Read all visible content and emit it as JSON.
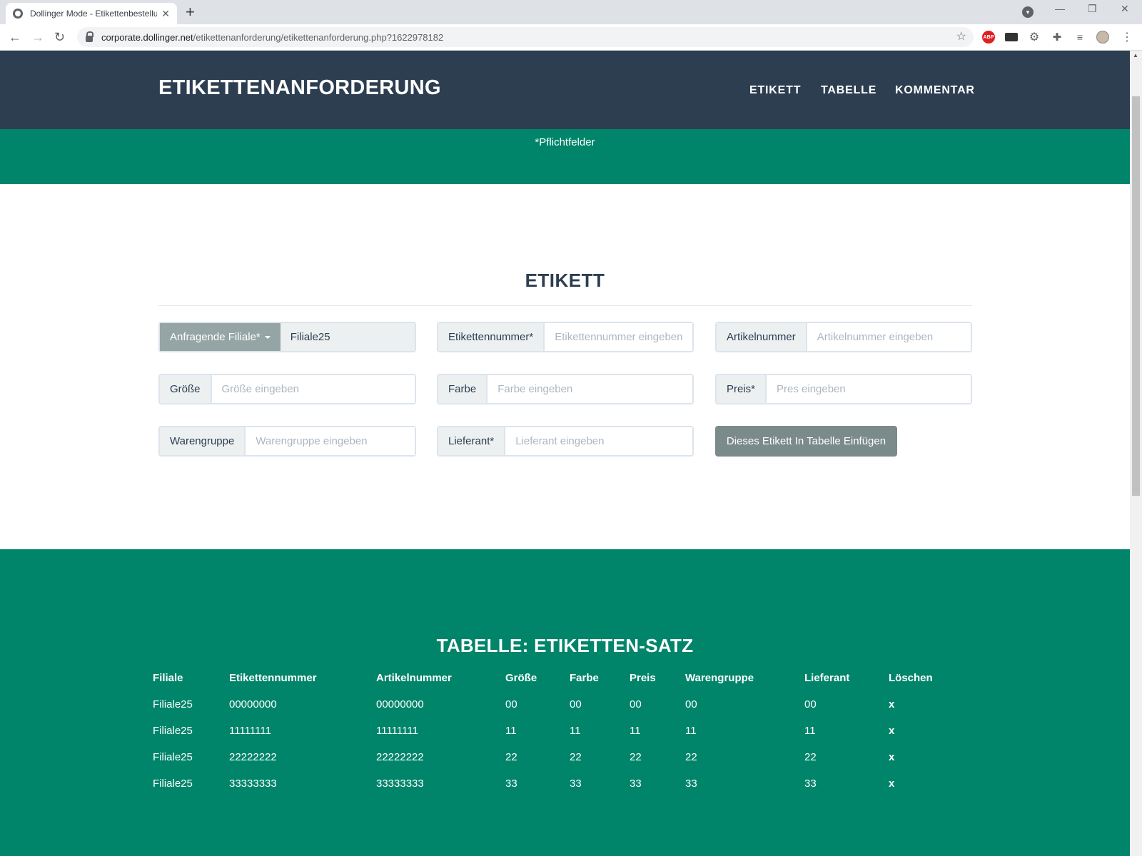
{
  "browser": {
    "tab_title": "Dollinger Mode - Etikettenbestellung",
    "url_host": "corporate.dollinger.net",
    "url_path": "/etikettenanforderung/etikettenanforderung.php?1622978182",
    "abp_label": "ABP"
  },
  "header": {
    "brand": "ETIKETTENANFORDERUNG",
    "nav": [
      "ETIKETT",
      "TABELLE",
      "KOMMENTAR"
    ]
  },
  "band": {
    "note": "*Pflichtfelder"
  },
  "form": {
    "title": "ETIKETT",
    "filiale": {
      "label": "Anfragende Filiale*",
      "value": "Filiale25"
    },
    "etikettennummer": {
      "label": "Etikettennummer*",
      "placeholder": "Etikettennummer eingeben"
    },
    "artikelnummer": {
      "label": "Artikelnummer",
      "placeholder": "Artikelnummer eingeben"
    },
    "groesse": {
      "label": "Größe",
      "placeholder": "Größe eingeben"
    },
    "farbe": {
      "label": "Farbe",
      "placeholder": "Farbe eingeben"
    },
    "preis": {
      "label": "Preis*",
      "placeholder": "Pres eingeben"
    },
    "warengruppe": {
      "label": "Warengruppe",
      "placeholder": "Warengruppe eingeben"
    },
    "lieferant": {
      "label": "Lieferant*",
      "placeholder": "Lieferant eingeben"
    },
    "submit_label": "Dieses Etikett In Tabelle Einfügen"
  },
  "table": {
    "title": "TABELLE: ETIKETTEN-SATZ",
    "headers": [
      "Filiale",
      "Etikettennummer",
      "Artikelnummer",
      "Größe",
      "Farbe",
      "Preis",
      "Warengruppe",
      "Lieferant",
      "Löschen"
    ],
    "rows": [
      [
        "Filiale25",
        "00000000",
        "00000000",
        "00",
        "00",
        "00",
        "00",
        "00",
        "x"
      ],
      [
        "Filiale25",
        "11111111",
        "11111111",
        "11",
        "11",
        "11",
        "11",
        "11",
        "x"
      ],
      [
        "Filiale25",
        "22222222",
        "22222222",
        "22",
        "22",
        "22",
        "22",
        "22",
        "x"
      ],
      [
        "Filiale25",
        "33333333",
        "33333333",
        "33",
        "33",
        "33",
        "33",
        "33",
        "x"
      ]
    ]
  }
}
